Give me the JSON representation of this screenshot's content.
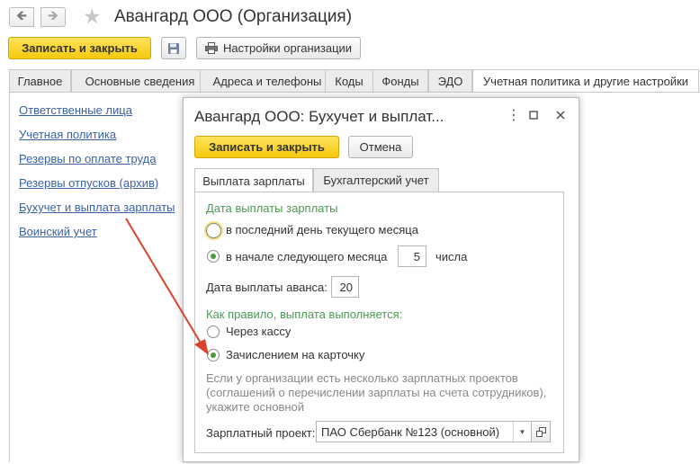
{
  "window": {
    "title": "Авангард ООО (Организация)",
    "back_icon": "arrow-left-icon",
    "forward_icon": "arrow-right-icon",
    "favorite_icon": "star-icon"
  },
  "toolbar": {
    "save_close_label": "Записать и закрыть",
    "save_icon": "floppy-disk-icon",
    "settings_label": "Настройки организации",
    "settings_icon": "printer-icon"
  },
  "tabs": [
    {
      "label": "Главное",
      "active": false
    },
    {
      "label": "Основные сведения",
      "active": false
    },
    {
      "label": "Адреса и телефоны",
      "active": false
    },
    {
      "label": "Коды",
      "active": false
    },
    {
      "label": "Фонды",
      "active": false
    },
    {
      "label": "ЭДО",
      "active": false
    },
    {
      "label": "Учетная политика и другие настройки",
      "active": true
    }
  ],
  "sidebar_links": [
    {
      "label": "Ответственные лица"
    },
    {
      "label": "Учетная политика"
    },
    {
      "label": "Резервы по оплате труда"
    },
    {
      "label": "Резервы отпусков (архив)"
    },
    {
      "label": "Бухучет и выплата зарплаты"
    },
    {
      "label": "Воинский учет"
    }
  ],
  "dialog": {
    "title": "Авангард ООО: Бухучет и выплат...",
    "save_close_label": "Записать и закрыть",
    "cancel_label": "Отмена",
    "tabs": [
      {
        "label": "Выплата зарплаты",
        "active": true
      },
      {
        "label": "Бухгалтерский учет",
        "active": false
      }
    ],
    "payment_date": {
      "group_title": "Дата выплаты зарплаты",
      "option_last_day": "в последний день текущего месяца",
      "option_next_month": "в начале следующего месяца",
      "day_value": "5",
      "day_suffix": "числа",
      "selected": "next_month"
    },
    "advance": {
      "label": "Дата выплаты аванса:",
      "value": "20"
    },
    "payment_method": {
      "group_title": "Как правило, выплата выполняется:",
      "option_cash": "Через кассу",
      "option_card": "Зачислением на карточку",
      "selected": "card"
    },
    "hint": "Если у организации есть несколько зарплатных проектов (соглашений о перечислении зарплаты на счета сотрудников), укажите основной",
    "salary_project": {
      "label": "Зарплатный проект:",
      "value": "ПАО Сбербанк №123 (основной)"
    }
  },
  "colors": {
    "accent_yellow": "#f5c90d",
    "link_blue": "#3a62a5",
    "group_green": "#4b9a54",
    "arrow_red": "#d9422c"
  }
}
